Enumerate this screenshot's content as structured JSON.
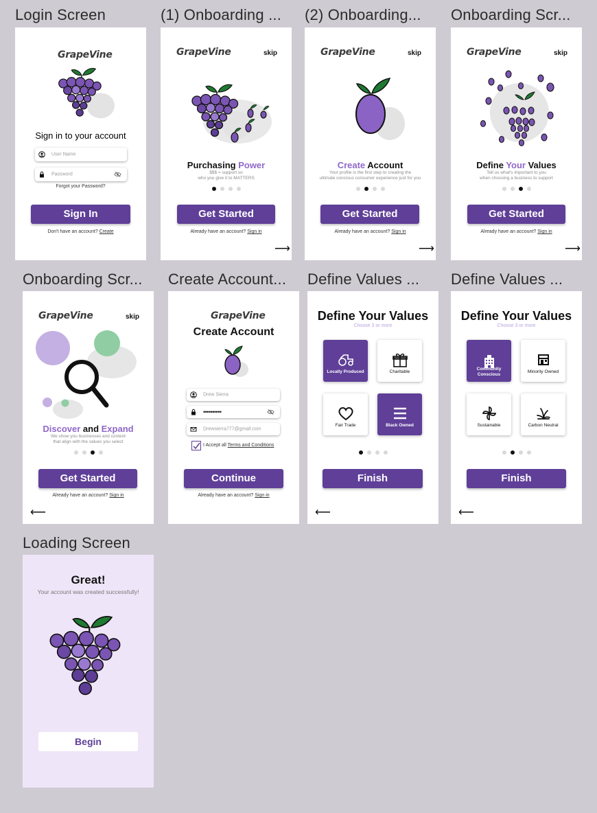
{
  "frames": {
    "login": {
      "title": "Login Screen",
      "logo": "GrapeVine",
      "heading": "Sign in to your account",
      "username_placeholder": "User Name",
      "password_placeholder": "Password",
      "forgot": "Forgot your Password?",
      "button": "Sign In",
      "footer_text": "Don't have an account?",
      "footer_link": "Create"
    },
    "onb1": {
      "title": "(1) Onboarding ...",
      "logo": "GrapeVine",
      "skip": "skip",
      "heading_a": "Purchasing ",
      "heading_b": "Power",
      "sub1": "$$$ = support so",
      "sub2": "who you give it to MATTERS",
      "button": "Get Started",
      "footer_text": "Already have an account?",
      "footer_link": "Sign in",
      "arrow": "⟶",
      "active_dot": 0
    },
    "onb2": {
      "title": "(2) Onboarding...",
      "logo": "GrapeVine",
      "skip": "skip",
      "heading_a": "Create",
      "heading_b": " Account",
      "sub1": "Your profile is the first step to creating the",
      "sub2": "ultimate concious consumer experience just for you",
      "button": "Get Started",
      "footer_text": "Already have an account?",
      "footer_link": "Sign in",
      "arrow": "⟶",
      "active_dot": 1
    },
    "onb3": {
      "title": "Onboarding Scr...",
      "logo": "GrapeVine",
      "skip": "skip",
      "heading_a": "Define ",
      "heading_b": "Your",
      "heading_c": " Values",
      "sub1": "Tell us what's important to you",
      "sub2": "when choosing a business to support",
      "button": "Get Started",
      "footer_text": "Already have an account?",
      "footer_link": "Sign in",
      "arrow": "⟶",
      "active_dot": 2
    },
    "onb4": {
      "title": "Onboarding Scr...",
      "logo": "GrapeVine",
      "skip": "skip",
      "heading_a": "Discover",
      "heading_b": " and ",
      "heading_c": "Expand",
      "sub1": "We show you businesses and content",
      "sub2": "that align with the values you select",
      "button": "Get Started",
      "footer_text": "Already have an account?",
      "footer_link": "Sign in",
      "arrow": "⟵",
      "active_dot": 3
    },
    "create": {
      "title": "Create Account...",
      "logo": "GrapeVine",
      "heading": "Create Account",
      "name_value": "Drew Sierra",
      "password_value": "••••••••••",
      "email_value": "Drewsierra777@gmail.com",
      "accept_text": "I Accept all ",
      "accept_link": "Terms and Conditions",
      "button": "Continue",
      "footer_text": "Already have an account?",
      "footer_link": "Sign in"
    },
    "values1": {
      "title": "Define Values ...",
      "heading": "Define Your Values",
      "sub": "Choose 3 or more",
      "cards": [
        {
          "label": "Locally Produced",
          "selected": true,
          "icon": "tractor-icon"
        },
        {
          "label": "Charitable",
          "selected": false,
          "icon": "gift-icon"
        },
        {
          "label": "Fair Trade",
          "selected": false,
          "icon": "heart-icon"
        },
        {
          "label": "Black Owned",
          "selected": true,
          "icon": "menu-icon"
        }
      ],
      "button": "Finish",
      "arrow": "⟵",
      "active_dot": 0
    },
    "values2": {
      "title": "Define Values ...",
      "heading": "Define Your Values",
      "sub": "Choose 3 or more",
      "cards": [
        {
          "label": "Community Conscious",
          "selected": true,
          "icon": "building-icon"
        },
        {
          "label": "Minority Owned",
          "selected": false,
          "icon": "store-icon"
        },
        {
          "label": "Sustainable",
          "selected": false,
          "icon": "pinwheel-icon"
        },
        {
          "label": "Carbon Neutral",
          "selected": false,
          "icon": "plant-icon"
        }
      ],
      "button": "Finish",
      "arrow": "⟵",
      "active_dot": 1
    },
    "loading": {
      "title": "Loading Screen",
      "heading": "Great!",
      "sub": "Your account was created successfully!",
      "button": "Begin"
    }
  },
  "colors": {
    "accent": "#5f3f98",
    "accent_light": "#8f68c9",
    "grape": "#7b55b3",
    "grape_dark": "#4f3389",
    "leaf": "#1f7a32",
    "canvas": "#cfcbd2",
    "loading_bg": "#efe5f8"
  }
}
